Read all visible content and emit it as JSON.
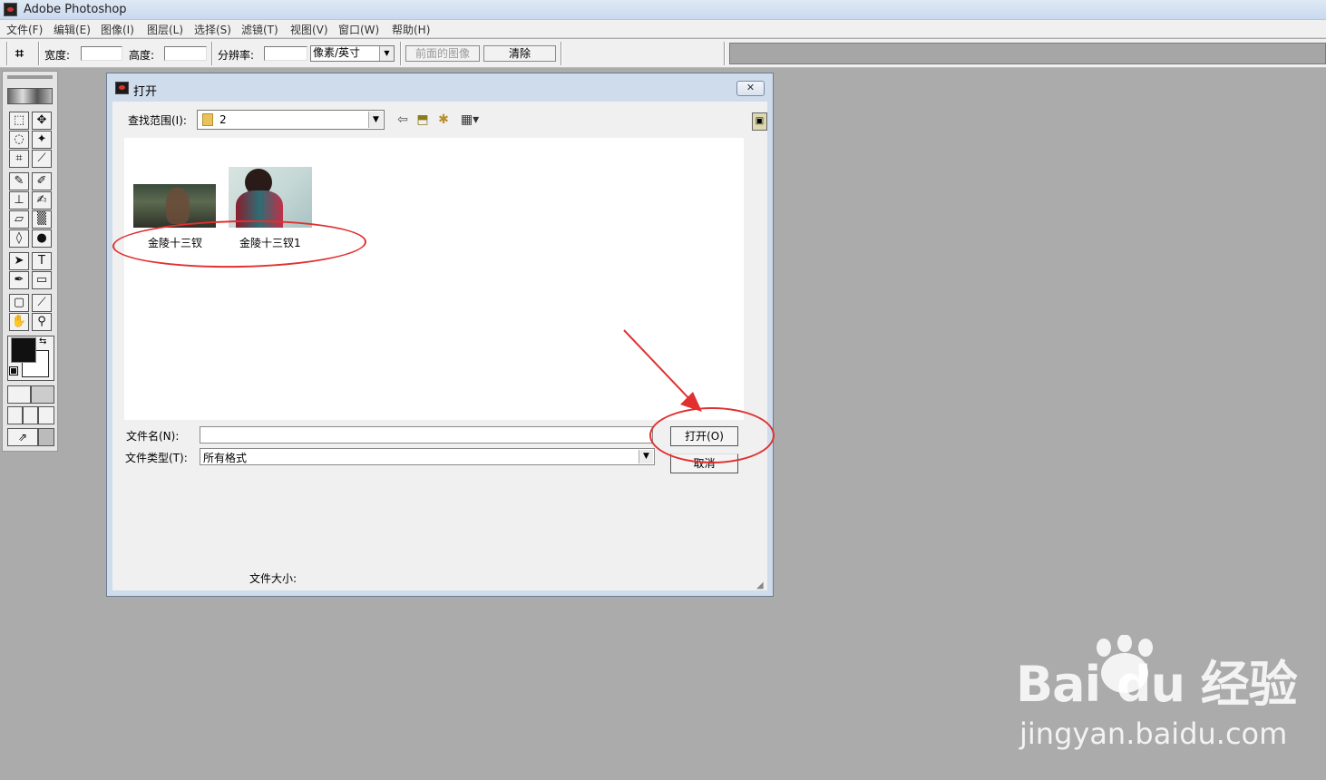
{
  "app": {
    "title": "Adobe Photoshop"
  },
  "menu": [
    "文件(F)",
    "编辑(E)",
    "图像(I)",
    "图层(L)",
    "选择(S)",
    "滤镜(T)",
    "视图(V)",
    "窗口(W)",
    "帮助(H)"
  ],
  "options_bar": {
    "width_label": "宽度:",
    "height_label": "高度:",
    "resolution_label": "分辨率:",
    "unit_value": "像素/英寸",
    "front_image_button": "前面的图像",
    "clear_button": "清除"
  },
  "dialog": {
    "title": "打开",
    "close_glyph": "✕",
    "look_in_label": "查找范围(I):",
    "look_in_value": "2",
    "files": [
      {
        "name": "金陵十三钗"
      },
      {
        "name": "金陵十三钗1"
      }
    ],
    "filename_label": "文件名(N):",
    "filename_value": "",
    "filetype_label": "文件类型(T):",
    "filetype_value": "所有格式",
    "open_button": "打开(O)",
    "cancel_button": "取消",
    "filesize_label": "文件大小:"
  },
  "icons": {
    "back": "back-arrow-icon",
    "up": "up-folder-icon",
    "new_folder": "new-folder-icon",
    "view_menu": "view-menu-icon"
  },
  "colors": {
    "annotation_red": "#e03030",
    "workspace_gray": "#ababab",
    "foreground": "#111111",
    "background": "#ffffff"
  },
  "watermark": {
    "brand": "Bai du 经验",
    "url": "jingyan.baidu.com"
  }
}
